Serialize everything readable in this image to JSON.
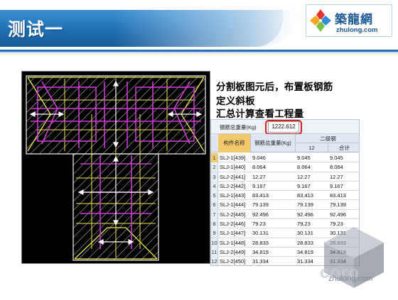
{
  "slide": {
    "title": "测试一",
    "logo_cn": "築龍網",
    "logo_en": "zhulong.com"
  },
  "description": [
    "分割板图元后，布置板钢筋",
    "定义斜板",
    "汇总计算查看工程量"
  ],
  "table": {
    "summary_label": "钢筋总重量(Kg)",
    "summary_value": "1222.612",
    "headers": {
      "name": "构件名称",
      "weight": "钢筋总重量(Kg)",
      "grade": "二级钢",
      "d12": "12",
      "total": "合计"
    },
    "rows": [
      {
        "idx": "1",
        "name": "SLJ-1[439]",
        "weight": "9.046",
        "d12": "9.045",
        "total": "9.045"
      },
      {
        "idx": "2",
        "name": "SLJ-1[440]",
        "weight": "8.064",
        "d12": "8.064",
        "total": "8.064"
      },
      {
        "idx": "3",
        "name": "SLJ-2[441]",
        "weight": "12.27",
        "d12": "12.27",
        "total": "12.27"
      },
      {
        "idx": "4",
        "name": "SLJ-2[442]",
        "weight": "9.167",
        "d12": "9.167",
        "total": "9.167"
      },
      {
        "idx": "5",
        "name": "SLJ-1[443]",
        "weight": "83.413",
        "d12": "83.413",
        "total": "83.413"
      },
      {
        "idx": "6",
        "name": "SLJ-1[444]",
        "weight": "79.139",
        "d12": "79.139",
        "total": "79.139"
      },
      {
        "idx": "7",
        "name": "SLJ-2[445]",
        "weight": "92.496",
        "d12": "92.496",
        "total": "92.496"
      },
      {
        "idx": "8",
        "name": "SLJ-2[446]",
        "weight": "79.23",
        "d12": "79.23",
        "total": "79.23"
      },
      {
        "idx": "9",
        "name": "SLJ-1[447]",
        "weight": "30.131",
        "d12": "30.131",
        "total": "30.131"
      },
      {
        "idx": "10",
        "name": "SLJ-1[448]",
        "weight": "28.833",
        "d12": "28.833",
        "total": "28.833"
      },
      {
        "idx": "11",
        "name": "SLJ-2[449]",
        "weight": "34.819",
        "d12": "34.819",
        "total": "34.819"
      },
      {
        "idx": "12",
        "name": "SLJ-2[450]",
        "weight": "31.334",
        "d12": "31.334",
        "total": "31.334"
      }
    ]
  },
  "watermark": {
    "text": "coro",
    "url": "zhulong.com"
  },
  "colors": {
    "header_blue": "#1f6fb4",
    "cad_background": "#000000",
    "rebar_magenta": "#d23bd6",
    "slab_yellow": "#f2ec4a",
    "hatch_white": "#e8e8e8",
    "highlight_red": "#d81f1f",
    "selected_row": "#f3c96c"
  },
  "icons": {
    "logo": "zhulong-diamond-logo",
    "arrows": "double-arrow-icon"
  }
}
